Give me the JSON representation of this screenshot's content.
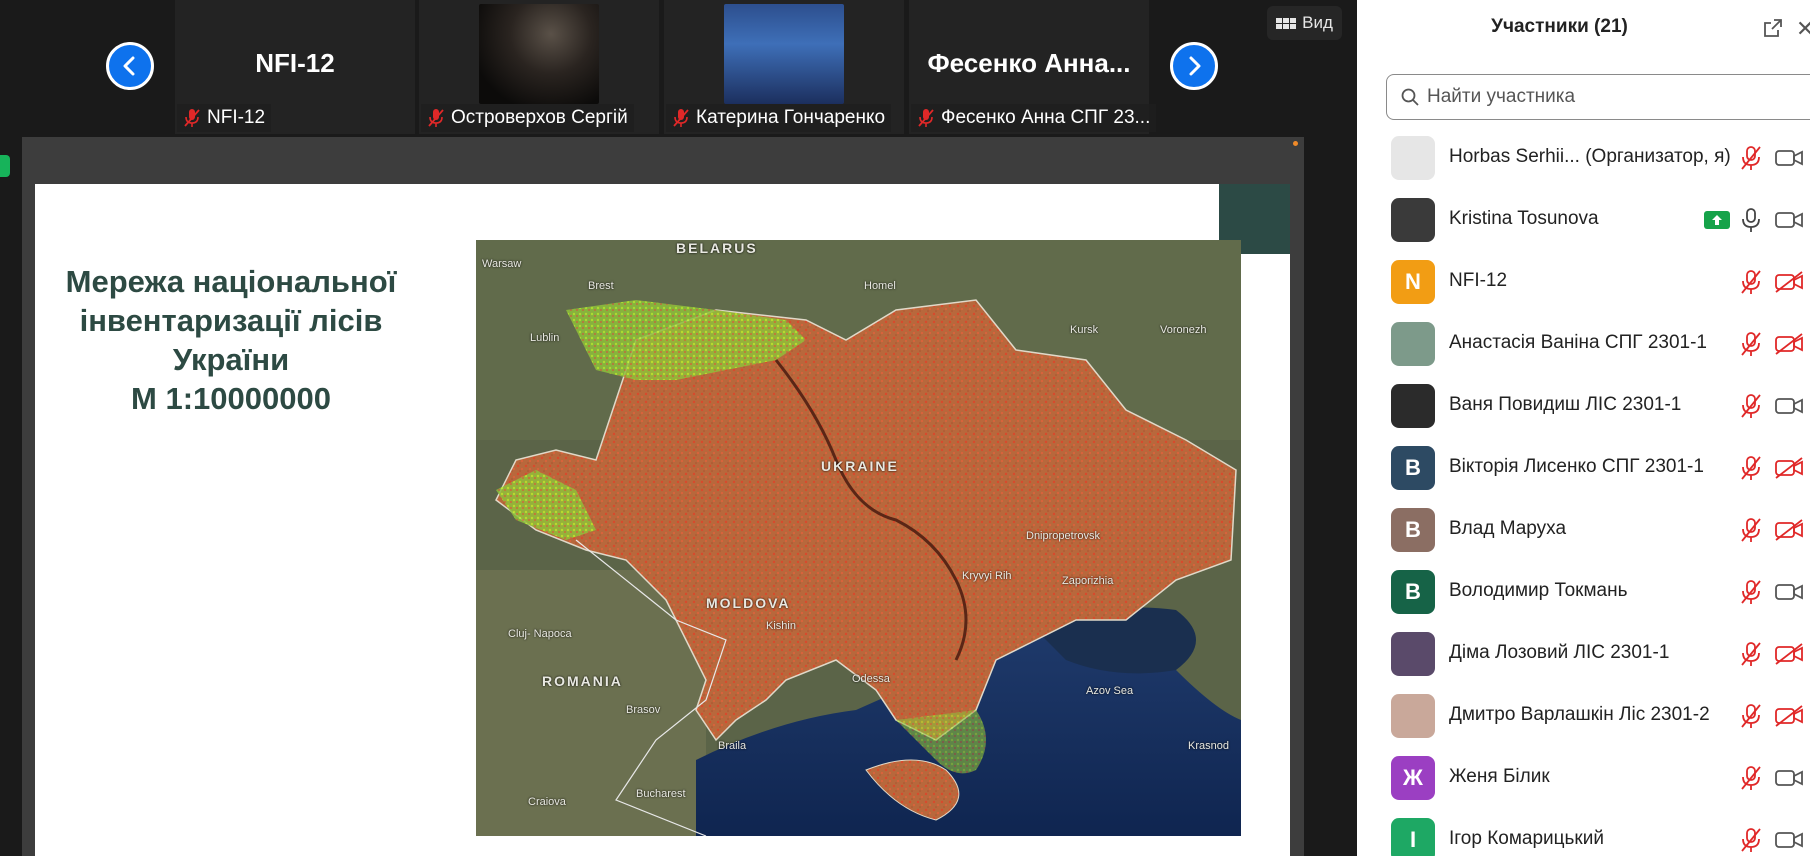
{
  "meeting": {
    "view_label": "Вид",
    "tiles": [
      {
        "name_text": "NFI-12",
        "label": "NFI-12"
      },
      {
        "name_text": "",
        "label": "Островерхов Сергій"
      },
      {
        "name_text": "",
        "label": "Катерина Гончаренко"
      },
      {
        "name_text": "Фесенко  Анна...",
        "label": "Фесенко Анна СПГ 23..."
      }
    ]
  },
  "slide": {
    "title_line1": "Мережа національної",
    "title_line2": "інвентаризації лісів",
    "title_line3": "України",
    "title_line4": "М 1:10000000",
    "map_labels": {
      "belarus": "BELARUS",
      "ukraine": "UKRAINE",
      "moldova": "MOLDOVA",
      "romania": "ROMANIA",
      "warsaw": "Warsaw",
      "brest": "Brest",
      "lublin": "Lublin",
      "homel": "Homel",
      "kursk": "Kursk",
      "voronezh": "Voronezh",
      "odessa": "Odessa",
      "azov": "Azov Sea",
      "bucharest": "Bucharest",
      "cluj": "Cluj-\nNapoca",
      "kishinev": "Kishin",
      "brasov": "Brasov",
      "braila": "Braila",
      "craiova": "Craiova",
      "krasnodar": "Krasnod",
      "dnipro": "Dnipropetrovsk",
      "zaporizhia": "Zaporizhia",
      "kryvyi": "Kryvyi Rih"
    }
  },
  "panel": {
    "title": "Участники (21)",
    "search_placeholder": "Найти участника",
    "participants": [
      {
        "name": "Horbas Serhii... (Организатор, я)",
        "initial": "",
        "color": "#e6e6e6",
        "mic": "off",
        "cam": "on"
      },
      {
        "name": "Kristina Tosunova",
        "initial": "",
        "color": "#3a3a3a",
        "mic": "on",
        "cam": "on",
        "sharing": true
      },
      {
        "name": "NFI-12",
        "initial": "N",
        "color": "#f29d14",
        "mic": "off",
        "cam": "off"
      },
      {
        "name": "Анастасія Ваніна СПГ 2301-1",
        "initial": "",
        "color": "#7d9a8a",
        "mic": "off",
        "cam": "off"
      },
      {
        "name": "Ваня Повидиш ЛІС 2301-1",
        "initial": "",
        "color": "#2b2b2b",
        "mic": "off",
        "cam": "on"
      },
      {
        "name": "Вікторія Лисенко СПГ 2301-1",
        "initial": "B",
        "color": "#2d4a63",
        "mic": "off",
        "cam": "off"
      },
      {
        "name": "Влад Маруха",
        "initial": "В",
        "color": "#8b6e63",
        "mic": "off",
        "cam": "off"
      },
      {
        "name": "Володимир Токмань",
        "initial": "В",
        "color": "#166347",
        "mic": "off",
        "cam": "on"
      },
      {
        "name": "Діма Лозовий ЛІС 2301-1",
        "initial": "",
        "color": "#5a4a6a",
        "mic": "off",
        "cam": "off"
      },
      {
        "name": "Дмитро Варлашкін Ліс 2301-2",
        "initial": "",
        "color": "#c9a89a",
        "mic": "off",
        "cam": "off"
      },
      {
        "name": "Женя Білик",
        "initial": "Ж",
        "color": "#9b3fc2",
        "mic": "off",
        "cam": "on"
      },
      {
        "name": "Ігор Комарицький",
        "initial": "І",
        "color": "#1ea864",
        "mic": "off",
        "cam": "on"
      }
    ]
  }
}
